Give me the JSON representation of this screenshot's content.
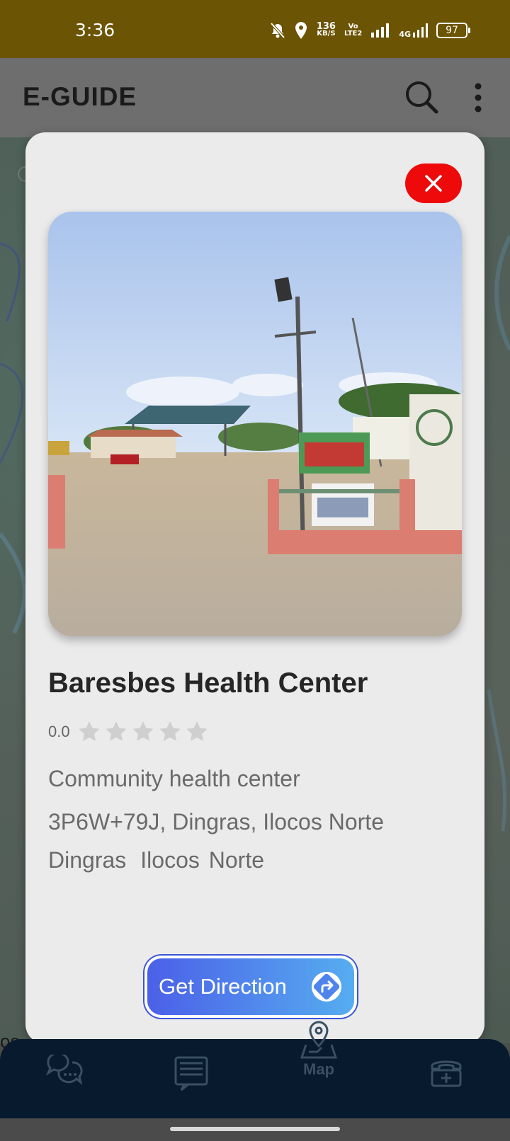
{
  "status_bar": {
    "time": "3:36",
    "net_speed_value": "136",
    "net_speed_unit": "KB/S",
    "volte_top": "Vo",
    "volte_bottom": "LTE2",
    "network_type": "4G",
    "battery": "97"
  },
  "app_bar": {
    "title": "E-GUIDE",
    "icons": [
      "search-icon",
      "more-vert-icon"
    ]
  },
  "map": {
    "partial_label": "os"
  },
  "place": {
    "name": "Baresbes Health Center",
    "rating_value": "0.0",
    "stars_filled": 0,
    "stars_total": 5,
    "category": "Community health center",
    "address": "3P6W+79J, Dingras, Ilocos Norte",
    "city": "Dingras",
    "province": "Ilocos Norte",
    "photo_icon": "street-view-photo"
  },
  "actions": {
    "direction_label": "Get Direction"
  },
  "colors": {
    "status_bar": "#6c5405",
    "close_button": "#ee0a0a",
    "direction_gradient_start": "#4b5fe8",
    "direction_gradient_end": "#56aef0",
    "bottom_nav": "#071a2e"
  },
  "bottom_nav": {
    "items": [
      {
        "icon": "chat-bubbles-icon",
        "label": ""
      },
      {
        "icon": "news-icon",
        "label": ""
      },
      {
        "icon": "map-pin-icon",
        "label": "Map"
      },
      {
        "icon": "hospital-phone-icon",
        "label": ""
      }
    ],
    "active_index": 2
  }
}
